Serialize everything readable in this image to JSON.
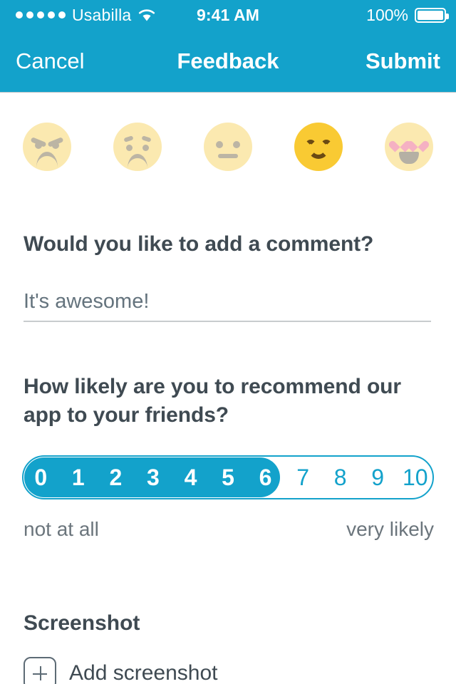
{
  "status_bar": {
    "signal_dots": 5,
    "carrier": "Usabilla",
    "wifi_icon": "wifi-icon",
    "time": "9:41 AM",
    "battery_percent": "100%",
    "battery_icon": "battery-full-icon"
  },
  "nav": {
    "cancel_label": "Cancel",
    "title": "Feedback",
    "submit_label": "Submit"
  },
  "mood": {
    "selected_index": 3,
    "options": [
      {
        "name": "angry",
        "label": "Angry"
      },
      {
        "name": "sad",
        "label": "Sad"
      },
      {
        "name": "neutral",
        "label": "Neutral"
      },
      {
        "name": "happy",
        "label": "Happy"
      },
      {
        "name": "love",
        "label": "In love"
      }
    ]
  },
  "comment": {
    "question": "Would you like to add a comment?",
    "value": "It's awesome!",
    "placeholder": "It's awesome!"
  },
  "nps": {
    "question": "How likely are you to recommend our app to your friends?",
    "values": [
      "0",
      "1",
      "2",
      "3",
      "4",
      "5",
      "6",
      "7",
      "8",
      "9",
      "10"
    ],
    "selected": "6",
    "min_label": "not at all",
    "max_label": "very likely"
  },
  "screenshot": {
    "title": "Screenshot",
    "add_label": "Add screenshot",
    "add_icon": "plus-square-icon"
  },
  "colors": {
    "brand_teal": "#13a2cb",
    "emoji_inactive": "#fbe9b0",
    "emoji_active": "#f9ca33",
    "heading": "#3f4a52"
  }
}
